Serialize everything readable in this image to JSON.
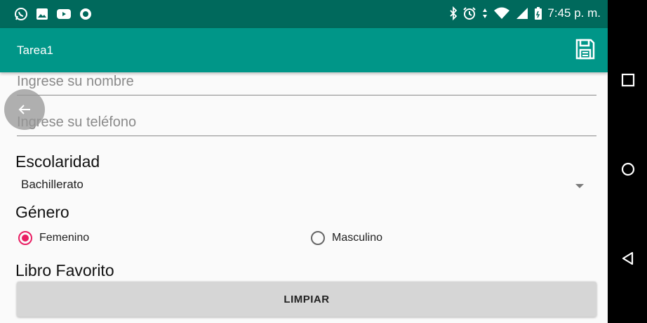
{
  "status_bar": {
    "time": "7:45 p. m.",
    "left_icons": [
      "whatsapp-icon",
      "gallery-icon",
      "youtube-icon",
      "circle-app-icon"
    ],
    "right_icons": [
      "bluetooth-icon",
      "alarm-icon",
      "data-arrows-icon",
      "wifi-icon",
      "signal-icon",
      "battery-icon"
    ]
  },
  "app_bar": {
    "title": "Tarea1",
    "action_icon": "save-icon"
  },
  "form": {
    "name_placeholder": "Ingrese su nombre",
    "phone_placeholder": "Ingrese su teléfono",
    "education_label": "Escolaridad",
    "education_value": "Bachillerato",
    "gender_label": "Género",
    "gender_options": [
      {
        "label": "Femenino",
        "selected": true
      },
      {
        "label": "Masculino",
        "selected": false
      }
    ],
    "book_label": "Libro Favorito",
    "clear_button": "LIMPIAR"
  },
  "colors": {
    "status_bar": "#00695c",
    "app_bar": "#009688",
    "accent": "#e91e63"
  },
  "nav_bar": {
    "buttons": [
      "recents-square-icon",
      "home-circle-icon",
      "back-triangle-icon"
    ]
  }
}
